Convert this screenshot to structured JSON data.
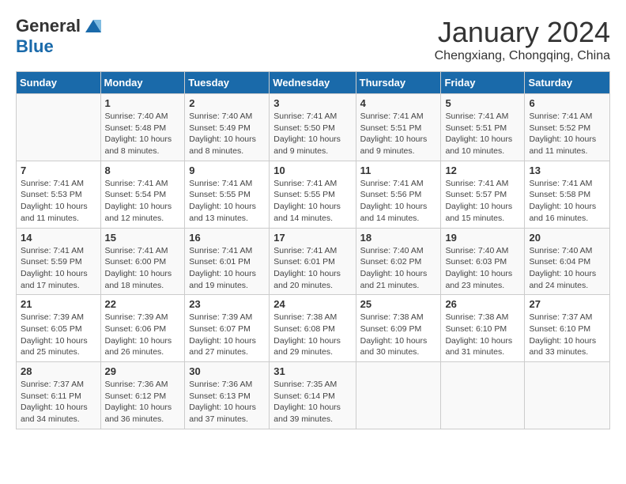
{
  "logo": {
    "general": "General",
    "blue": "Blue"
  },
  "title": "January 2024",
  "location": "Chengxiang, Chongqing, China",
  "days_of_week": [
    "Sunday",
    "Monday",
    "Tuesday",
    "Wednesday",
    "Thursday",
    "Friday",
    "Saturday"
  ],
  "weeks": [
    [
      {
        "num": "",
        "detail": ""
      },
      {
        "num": "1",
        "detail": "Sunrise: 7:40 AM\nSunset: 5:48 PM\nDaylight: 10 hours\nand 8 minutes."
      },
      {
        "num": "2",
        "detail": "Sunrise: 7:40 AM\nSunset: 5:49 PM\nDaylight: 10 hours\nand 8 minutes."
      },
      {
        "num": "3",
        "detail": "Sunrise: 7:41 AM\nSunset: 5:50 PM\nDaylight: 10 hours\nand 9 minutes."
      },
      {
        "num": "4",
        "detail": "Sunrise: 7:41 AM\nSunset: 5:51 PM\nDaylight: 10 hours\nand 9 minutes."
      },
      {
        "num": "5",
        "detail": "Sunrise: 7:41 AM\nSunset: 5:51 PM\nDaylight: 10 hours\nand 10 minutes."
      },
      {
        "num": "6",
        "detail": "Sunrise: 7:41 AM\nSunset: 5:52 PM\nDaylight: 10 hours\nand 11 minutes."
      }
    ],
    [
      {
        "num": "7",
        "detail": "Sunrise: 7:41 AM\nSunset: 5:53 PM\nDaylight: 10 hours\nand 11 minutes."
      },
      {
        "num": "8",
        "detail": "Sunrise: 7:41 AM\nSunset: 5:54 PM\nDaylight: 10 hours\nand 12 minutes."
      },
      {
        "num": "9",
        "detail": "Sunrise: 7:41 AM\nSunset: 5:55 PM\nDaylight: 10 hours\nand 13 minutes."
      },
      {
        "num": "10",
        "detail": "Sunrise: 7:41 AM\nSunset: 5:55 PM\nDaylight: 10 hours\nand 14 minutes."
      },
      {
        "num": "11",
        "detail": "Sunrise: 7:41 AM\nSunset: 5:56 PM\nDaylight: 10 hours\nand 14 minutes."
      },
      {
        "num": "12",
        "detail": "Sunrise: 7:41 AM\nSunset: 5:57 PM\nDaylight: 10 hours\nand 15 minutes."
      },
      {
        "num": "13",
        "detail": "Sunrise: 7:41 AM\nSunset: 5:58 PM\nDaylight: 10 hours\nand 16 minutes."
      }
    ],
    [
      {
        "num": "14",
        "detail": "Sunrise: 7:41 AM\nSunset: 5:59 PM\nDaylight: 10 hours\nand 17 minutes."
      },
      {
        "num": "15",
        "detail": "Sunrise: 7:41 AM\nSunset: 6:00 PM\nDaylight: 10 hours\nand 18 minutes."
      },
      {
        "num": "16",
        "detail": "Sunrise: 7:41 AM\nSunset: 6:01 PM\nDaylight: 10 hours\nand 19 minutes."
      },
      {
        "num": "17",
        "detail": "Sunrise: 7:41 AM\nSunset: 6:01 PM\nDaylight: 10 hours\nand 20 minutes."
      },
      {
        "num": "18",
        "detail": "Sunrise: 7:40 AM\nSunset: 6:02 PM\nDaylight: 10 hours\nand 21 minutes."
      },
      {
        "num": "19",
        "detail": "Sunrise: 7:40 AM\nSunset: 6:03 PM\nDaylight: 10 hours\nand 23 minutes."
      },
      {
        "num": "20",
        "detail": "Sunrise: 7:40 AM\nSunset: 6:04 PM\nDaylight: 10 hours\nand 24 minutes."
      }
    ],
    [
      {
        "num": "21",
        "detail": "Sunrise: 7:39 AM\nSunset: 6:05 PM\nDaylight: 10 hours\nand 25 minutes."
      },
      {
        "num": "22",
        "detail": "Sunrise: 7:39 AM\nSunset: 6:06 PM\nDaylight: 10 hours\nand 26 minutes."
      },
      {
        "num": "23",
        "detail": "Sunrise: 7:39 AM\nSunset: 6:07 PM\nDaylight: 10 hours\nand 27 minutes."
      },
      {
        "num": "24",
        "detail": "Sunrise: 7:38 AM\nSunset: 6:08 PM\nDaylight: 10 hours\nand 29 minutes."
      },
      {
        "num": "25",
        "detail": "Sunrise: 7:38 AM\nSunset: 6:09 PM\nDaylight: 10 hours\nand 30 minutes."
      },
      {
        "num": "26",
        "detail": "Sunrise: 7:38 AM\nSunset: 6:10 PM\nDaylight: 10 hours\nand 31 minutes."
      },
      {
        "num": "27",
        "detail": "Sunrise: 7:37 AM\nSunset: 6:10 PM\nDaylight: 10 hours\nand 33 minutes."
      }
    ],
    [
      {
        "num": "28",
        "detail": "Sunrise: 7:37 AM\nSunset: 6:11 PM\nDaylight: 10 hours\nand 34 minutes."
      },
      {
        "num": "29",
        "detail": "Sunrise: 7:36 AM\nSunset: 6:12 PM\nDaylight: 10 hours\nand 36 minutes."
      },
      {
        "num": "30",
        "detail": "Sunrise: 7:36 AM\nSunset: 6:13 PM\nDaylight: 10 hours\nand 37 minutes."
      },
      {
        "num": "31",
        "detail": "Sunrise: 7:35 AM\nSunset: 6:14 PM\nDaylight: 10 hours\nand 39 minutes."
      },
      {
        "num": "",
        "detail": ""
      },
      {
        "num": "",
        "detail": ""
      },
      {
        "num": "",
        "detail": ""
      }
    ]
  ]
}
